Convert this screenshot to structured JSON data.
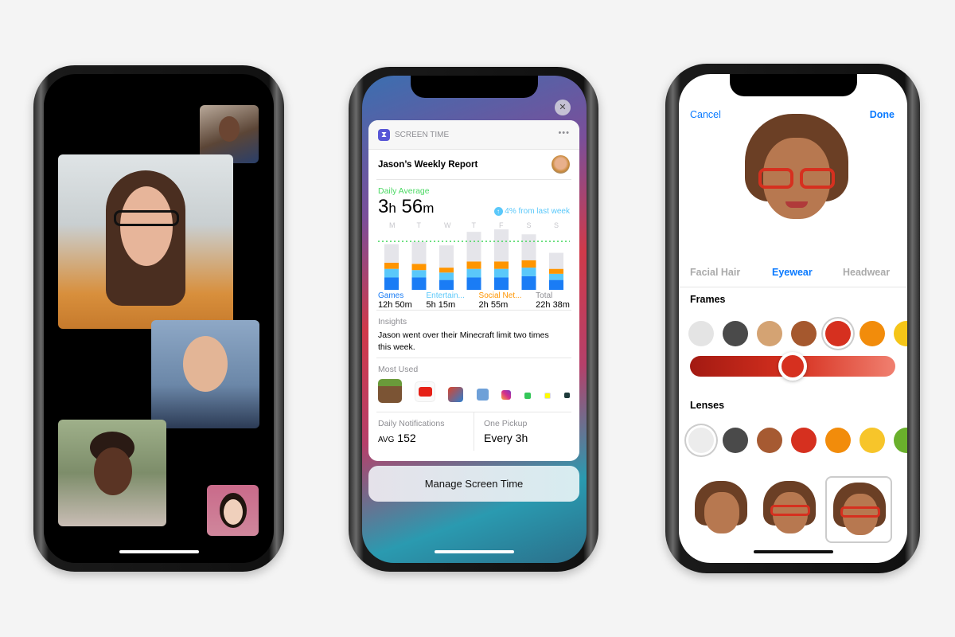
{
  "facetime": {
    "participants": [
      "participant-1",
      "participant-2",
      "participant-3",
      "participant-4",
      "participant-5"
    ]
  },
  "screen_time": {
    "app_label": "SCREEN TIME",
    "more": "•••",
    "close": "✕",
    "report_title": "Jason’s Weekly Report",
    "daily_average_label": "Daily Average",
    "daily_average_h": "3",
    "h": "h",
    "daily_average_m": "56",
    "m": "m",
    "change": "4% from last week",
    "insights_label": "Insights",
    "insight": "Jason went over their Minecraft limit two times this week.",
    "most_used_label": "Most Used",
    "most_used_apps": [
      "minecraft",
      "youtube",
      "game",
      "fortnite",
      "instagram",
      "messages",
      "snapchat",
      "other"
    ],
    "notifications_label": "Daily Notifications",
    "notifications_prefix": "AVG",
    "notifications_value": "152",
    "pickup_label": "One Pickup",
    "pickup_value": "Every 3h",
    "manage_button": "Manage Screen Time"
  },
  "chart_data": {
    "type": "bar",
    "stacked": true,
    "categories": [
      "M",
      "T",
      "W",
      "T",
      "F",
      "S",
      "S"
    ],
    "series": [
      {
        "name": "Games",
        "total": "12h 50m",
        "color": "#1a7cf5",
        "values": [
          1.0,
          1.0,
          0.8,
          1.0,
          1.0,
          1.1,
          0.8
        ]
      },
      {
        "name": "Entertain...",
        "total": "5h 15m",
        "color": "#5ac8fa",
        "values": [
          0.7,
          0.6,
          0.6,
          0.7,
          0.7,
          0.7,
          0.5
        ]
      },
      {
        "name": "Social Net...",
        "total": "2h 55m",
        "color": "#ff9500",
        "values": [
          0.5,
          0.5,
          0.4,
          0.6,
          0.6,
          0.6,
          0.4
        ]
      },
      {
        "color": "#e5e5ea",
        "values": [
          1.5,
          1.8,
          1.8,
          2.4,
          2.6,
          2.1,
          1.3
        ]
      }
    ],
    "total_label": "Total",
    "total_value": "22h 38m",
    "average_line": 3.93,
    "average_line_color": "#4cd964"
  },
  "memoji": {
    "cancel": "Cancel",
    "done": "Done",
    "tabs": [
      "Facial Hair",
      "Eyewear",
      "Headwear"
    ],
    "active_tab": 1,
    "frames_label": "Frames",
    "frame_colors": [
      "#e4e4e4",
      "#4a4a4a",
      "#d4a373",
      "#a5582e",
      "#d6301f",
      "#f28c0b",
      "#f5c518"
    ],
    "frame_selected": 4,
    "frame_shade": 0.5,
    "lenses_label": "Lenses",
    "lens_colors": [
      "#ececec",
      "#4a4a4a",
      "#a65a32",
      "#d6301f",
      "#f28c0b",
      "#f7c52a",
      "#6ab02c"
    ],
    "lens_selected": 0,
    "presets": [
      "no-glasses",
      "glasses-clear",
      "glasses-selected"
    ],
    "preset_selected": 2,
    "accent": "#0a7aff"
  }
}
